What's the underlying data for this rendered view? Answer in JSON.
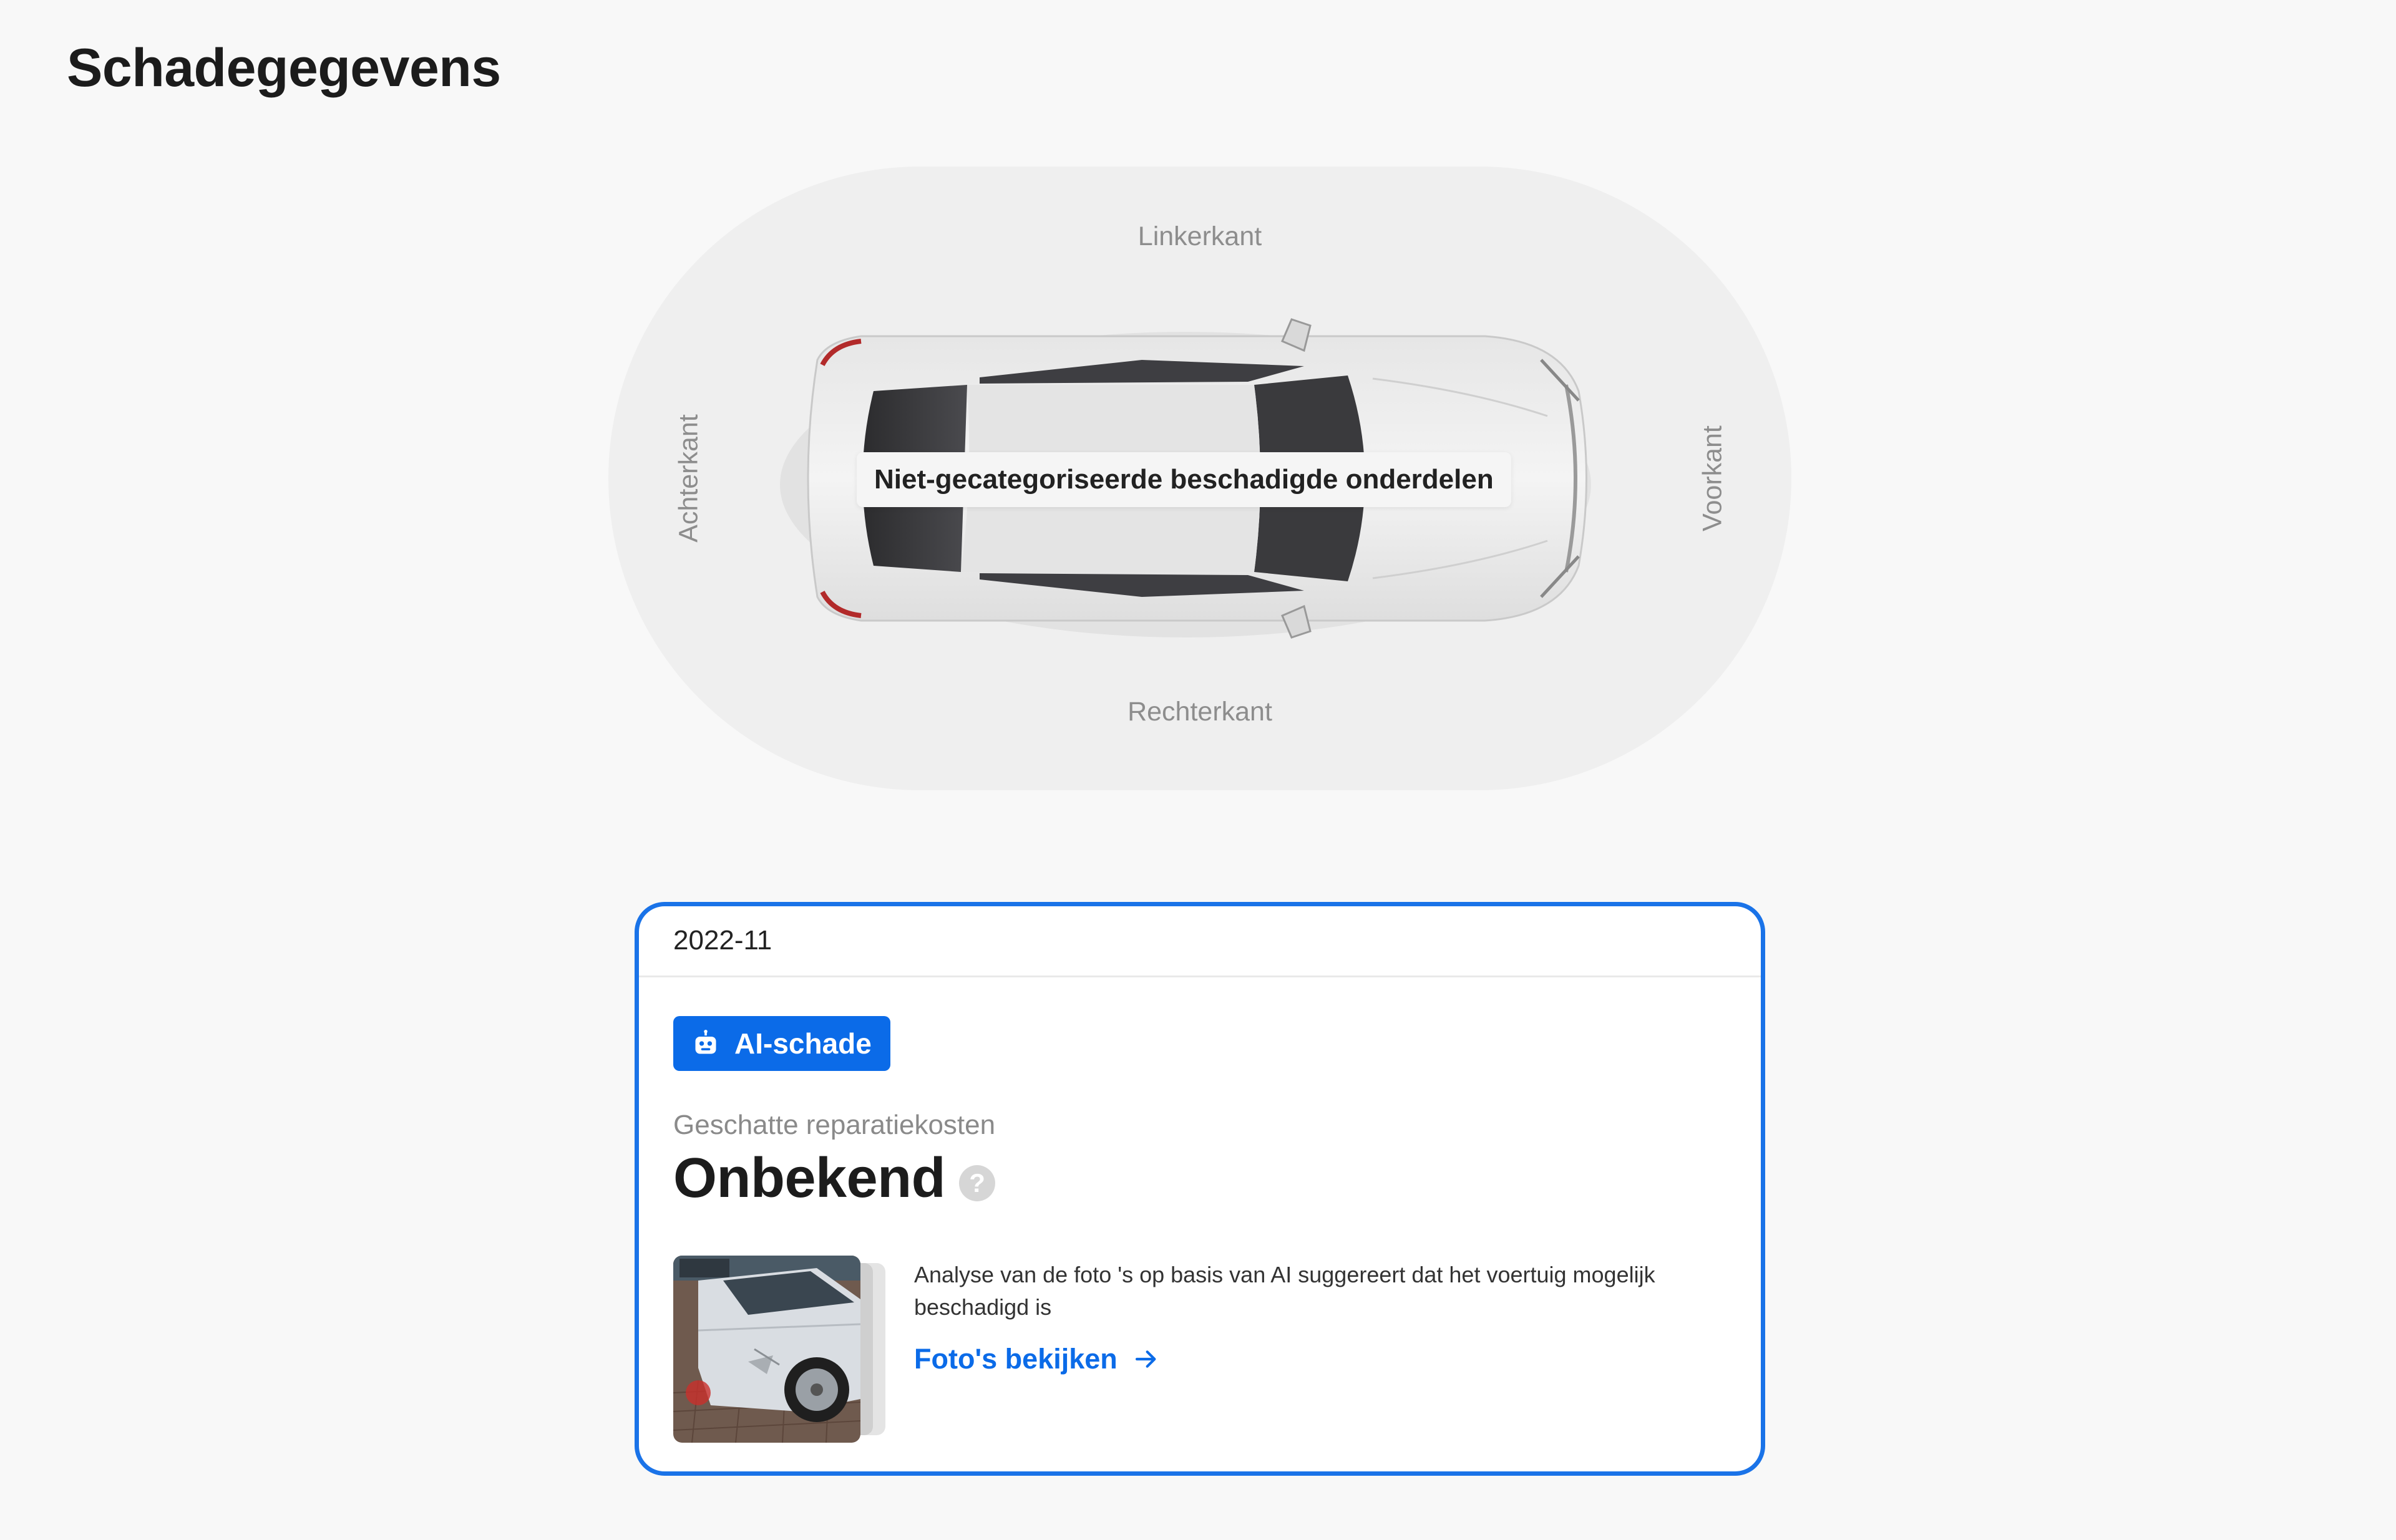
{
  "page": {
    "title": "Schadegegevens"
  },
  "diagram": {
    "labels": {
      "top": "Linkerkant",
      "bottom": "Rechterkant",
      "left": "Achterkant",
      "right": "Voorkant"
    },
    "tooltip": "Niet-gecategoriseerde beschadigde onderdelen"
  },
  "damage_card": {
    "date": "2022-11",
    "badge_icon": "robot-icon",
    "badge_label": "AI-schade",
    "cost_label": "Geschatte reparatiekosten",
    "cost_value": "Onbekend",
    "help_icon": "question-icon",
    "ai_description": "Analyse van de foto 's op basis van AI suggereert dat het voertuig mogelijk beschadigd is",
    "photos_link": "Foto's bekijken",
    "link_icon": "arrow-right-icon"
  },
  "colors": {
    "accent": "#0b6be8",
    "card_border": "#1a73e8",
    "background": "#f8f8f8",
    "diagram_background": "#efefef"
  }
}
